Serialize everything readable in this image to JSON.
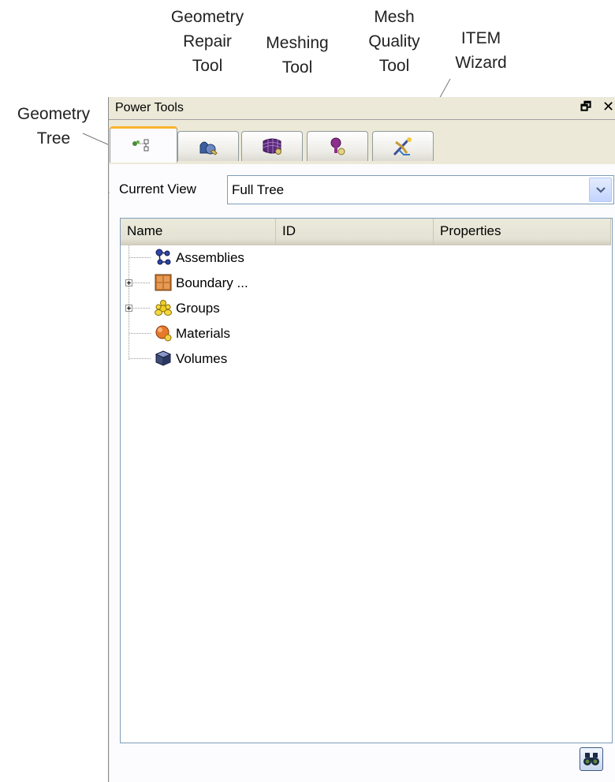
{
  "callouts": {
    "geometry_repair_tool": [
      "Geometry",
      "Repair",
      "Tool"
    ],
    "meshing_tool": [
      "Meshing",
      "Tool"
    ],
    "mesh_quality_tool": [
      "Mesh",
      "Quality",
      "Tool"
    ],
    "item_wizard": [
      "ITEM",
      "Wizard"
    ],
    "geometry_tree": [
      "Geometry",
      "Tree"
    ]
  },
  "panel": {
    "title": "Power Tools",
    "float_glyph": "🗗",
    "close_glyph": "✕"
  },
  "tabs": [
    {
      "icon": "geometry-tree-icon",
      "active": true
    },
    {
      "icon": "geometry-repair-icon",
      "active": false
    },
    {
      "icon": "meshing-icon",
      "active": false
    },
    {
      "icon": "mesh-quality-icon",
      "active": false
    },
    {
      "icon": "item-wizard-icon",
      "active": false
    }
  ],
  "current_view": {
    "label": "Current View",
    "value": "Full Tree"
  },
  "tree": {
    "columns": [
      "Name",
      "ID",
      "Properties"
    ],
    "rows": [
      {
        "label": "Assemblies",
        "icon": "assemblies-icon",
        "expandable": false
      },
      {
        "label": "Boundary ...",
        "icon": "boundary-icon",
        "expandable": true
      },
      {
        "label": "Groups",
        "icon": "groups-icon",
        "expandable": true
      },
      {
        "label": "Materials",
        "icon": "materials-icon",
        "expandable": false
      },
      {
        "label": "Volumes",
        "icon": "volumes-icon",
        "expandable": false
      }
    ]
  },
  "footer": {
    "search_icon": "binoculars-icon"
  },
  "colors": {
    "panel_bg": "#ece9d8",
    "active_tab_accent": "#f9b42b",
    "field_border": "#7f9db9"
  }
}
